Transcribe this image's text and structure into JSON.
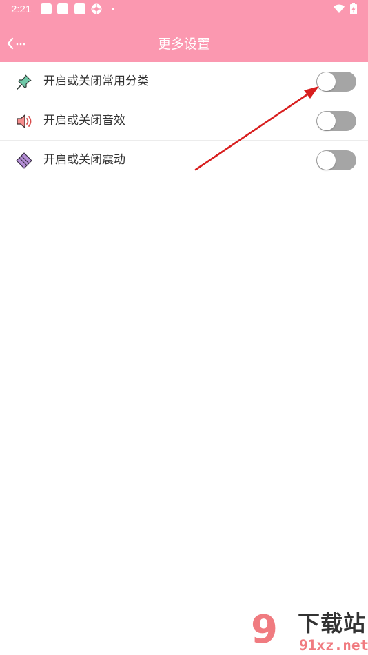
{
  "status_bar": {
    "time": "2:21",
    "icons": [
      "notification-square-icon",
      "notification-square-icon",
      "notification-square-icon",
      "aperture-icon",
      "dot-icon",
      "wifi-icon",
      "battery-charging-icon"
    ]
  },
  "app_bar": {
    "back_icon": "back-arrow-icon",
    "title": "更多设置",
    "background_color": "#fb98b0"
  },
  "settings": {
    "items": [
      {
        "label": "开启或关闭常用分类",
        "icon": "pin-icon",
        "enabled": false
      },
      {
        "label": "开启或关闭音效",
        "icon": "speaker-icon",
        "enabled": false
      },
      {
        "label": "开启或关闭震动",
        "icon": "vibrate-icon",
        "enabled": false
      }
    ]
  },
  "annotation": {
    "type": "red-arrow",
    "color": "#d81e1e"
  },
  "watermark": {
    "number": "9",
    "brand": "下载站",
    "url": "91xz.net"
  }
}
